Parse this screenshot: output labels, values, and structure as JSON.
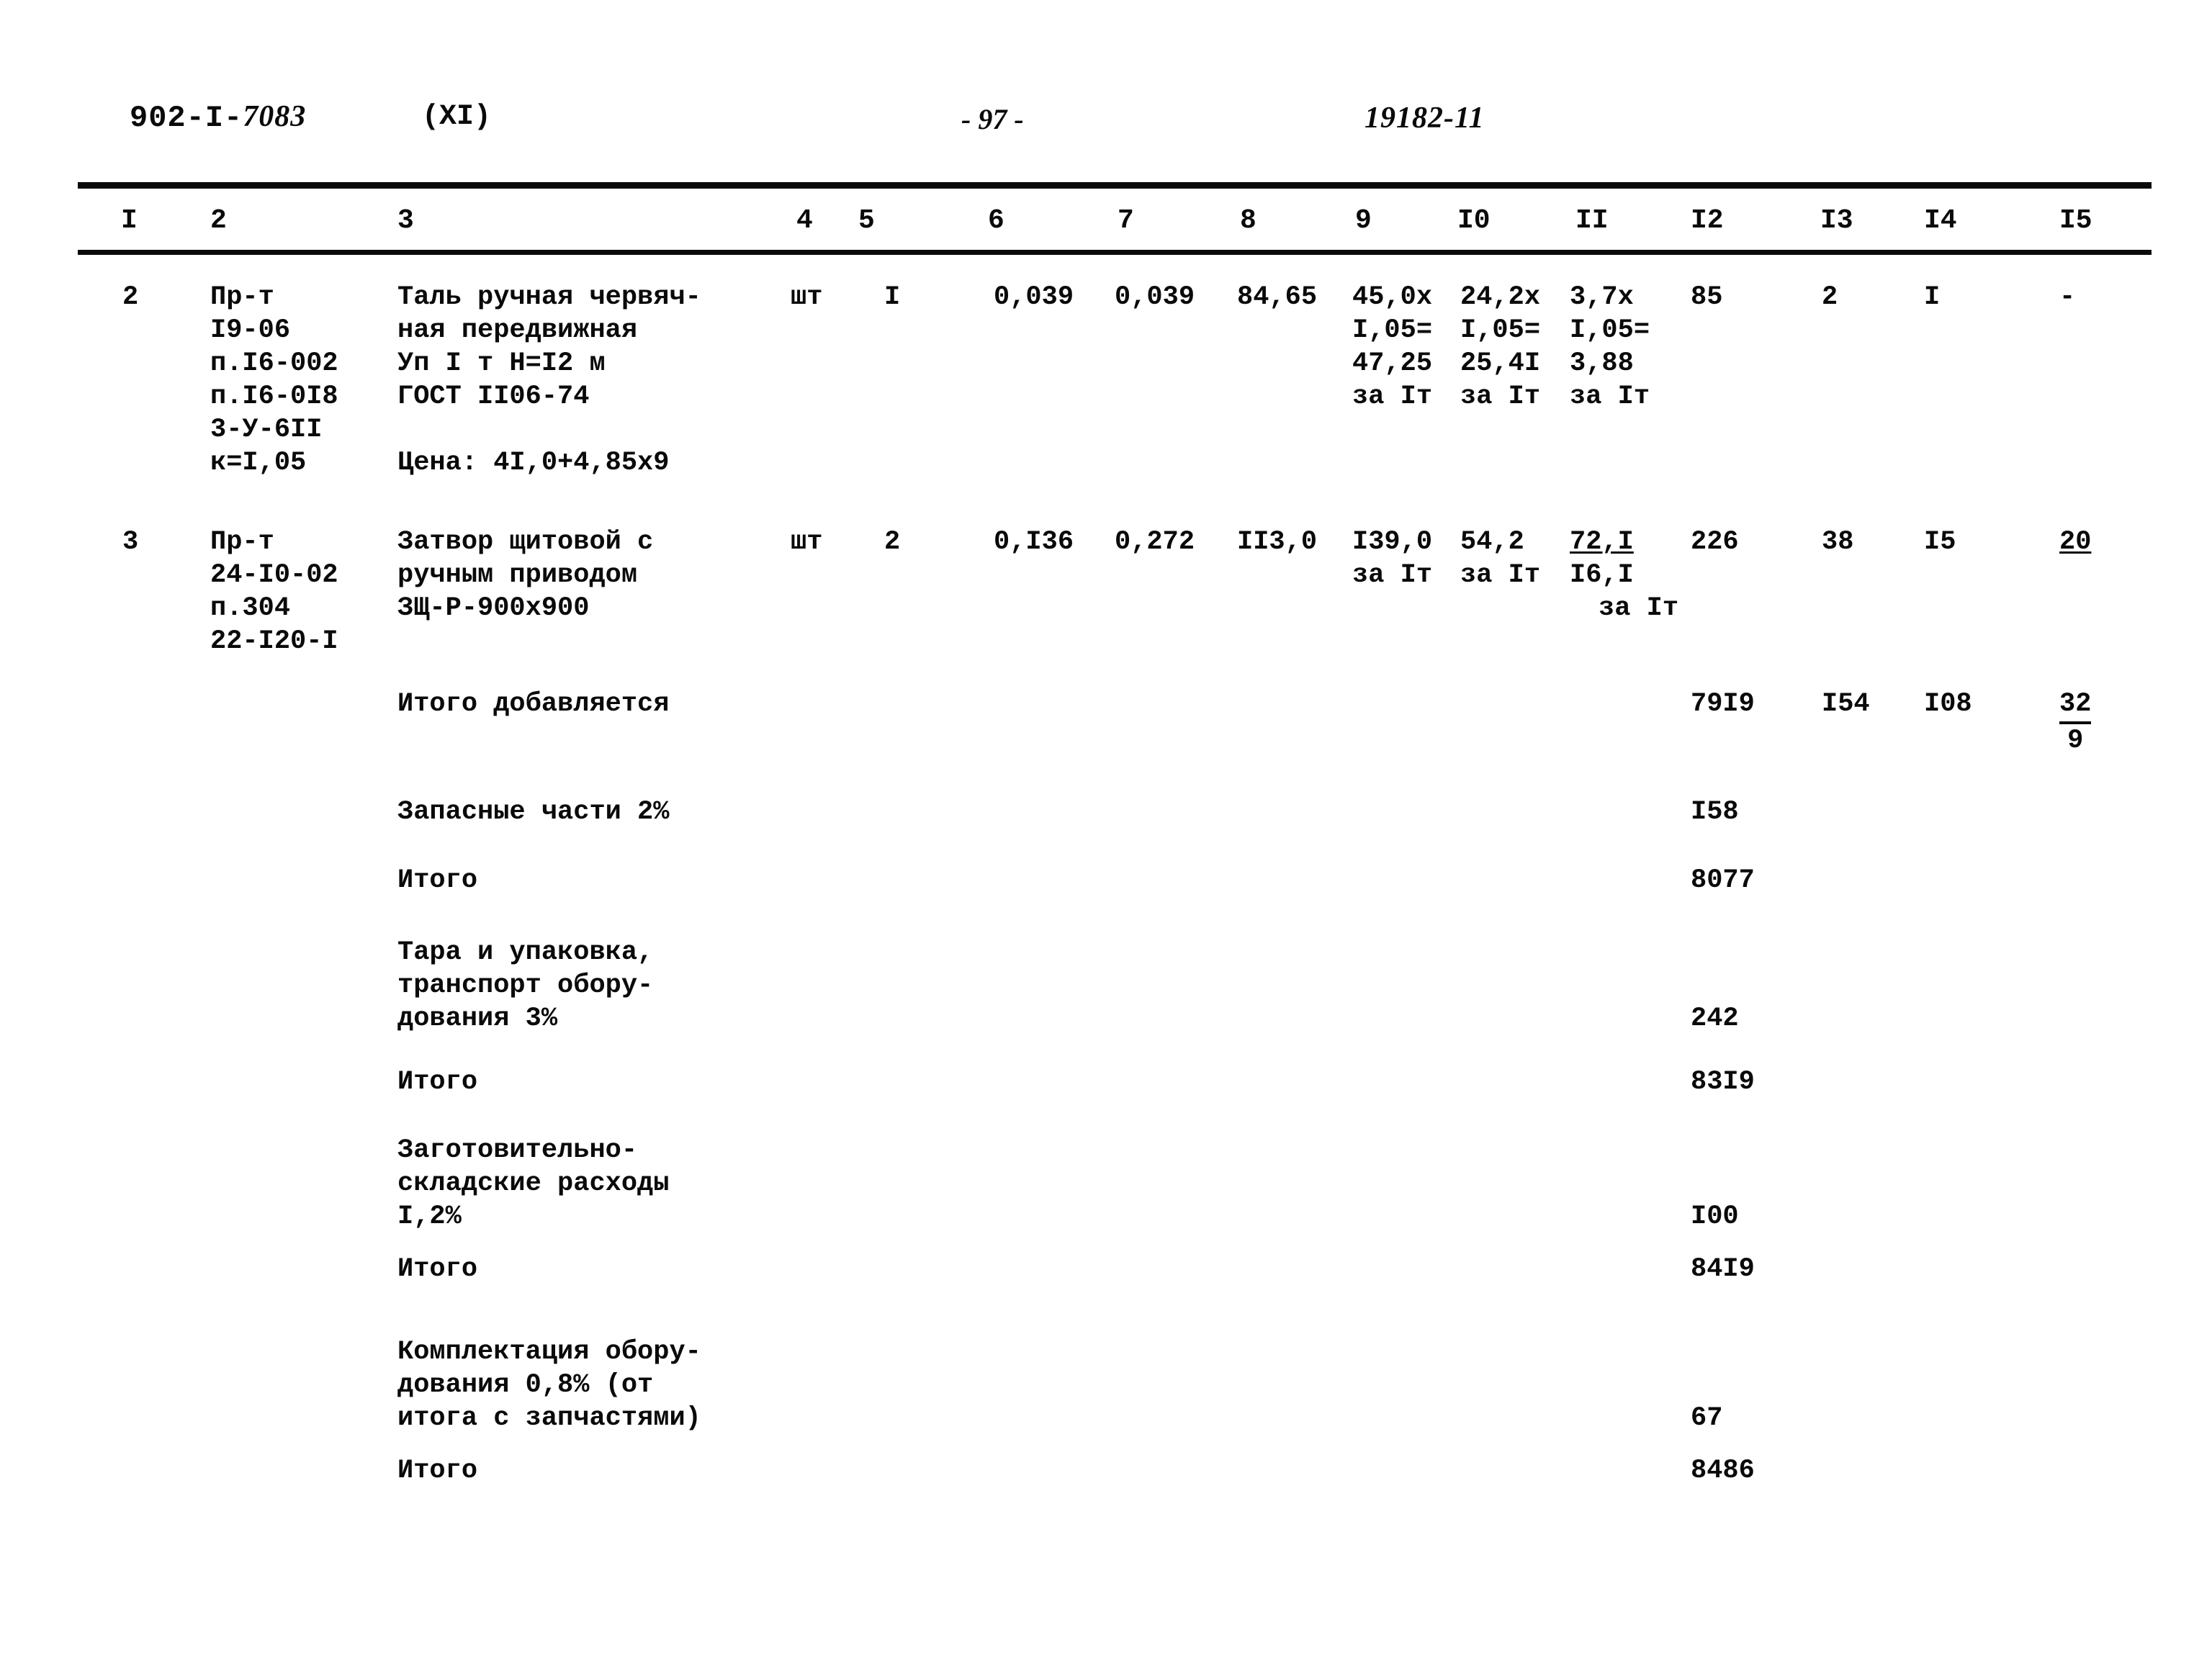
{
  "header": {
    "doc_code_prefix": "902-I-",
    "doc_code_hand": "7083",
    "volume": "(XI)",
    "page_number": "- 97 -",
    "archive_stamp": "19182-11"
  },
  "table": {
    "column_headers": [
      "I",
      "2",
      "3",
      "4",
      "5",
      "6",
      "7",
      "8",
      "9",
      "I0",
      "II",
      "I2",
      "I3",
      "I4",
      "I5"
    ],
    "rows": [
      {
        "pos": "2",
        "code_lines": [
          "Пр-т",
          "I9-06",
          "п.I6-002",
          "п.I6-0I8",
          "3-У-6II",
          "к=I,05"
        ],
        "name_lines": [
          "Таль ручная червяч-",
          "ная передвижная",
          "Уп I т Н=I2 м",
          "ГОСТ II06-74"
        ],
        "price_line": "Цена: 4I,0+4,85х9",
        "unit": "шт",
        "qty": "I",
        "c6": "0,039",
        "c7": "0,039",
        "c8": "84,65",
        "c9_lines": [
          "45,0х",
          "I,05=",
          "47,25",
          "за Iт"
        ],
        "c10_lines": [
          "24,2х",
          "I,05=",
          "25,4I",
          "за Iт"
        ],
        "c11_lines": [
          "3,7х",
          "I,05=",
          "3,88",
          "за Iт"
        ],
        "c12": "85",
        "c13": "2",
        "c14": "I",
        "c15": "-"
      },
      {
        "pos": "3",
        "code_lines": [
          "Пр-т",
          "24-I0-02",
          "п.304",
          "22-I20-I"
        ],
        "name_lines": [
          "Затвор щитовой с",
          "ручным приводом",
          "ЗЩ-Р-900х900"
        ],
        "price_line": "",
        "unit": "шт",
        "qty": "2",
        "c6": "0,I36",
        "c7": "0,272",
        "c8": "II3,0",
        "c9_lines": [
          "I39,0",
          "за Iт"
        ],
        "c10_lines": [
          "54,2",
          "за Iт"
        ],
        "c11_lines": [
          "72,I",
          "I6,I",
          "за Iт"
        ],
        "c12": "226",
        "c13": "38",
        "c14": "I5",
        "c15": "20"
      }
    ],
    "summary": [
      {
        "label_lines": [
          "Итого добавляется"
        ],
        "c12": "79I9",
        "c13": "I54",
        "c14": "I08",
        "c15_top": "32",
        "c15_bot": "9"
      },
      {
        "label_lines": [
          "Запасные части 2%"
        ],
        "c12": "I58"
      },
      {
        "label_lines": [
          "Итого"
        ],
        "c12": "8077"
      },
      {
        "label_lines": [
          "Тара и упаковка,",
          "транспорт обору-",
          "дования 3%"
        ],
        "c12": "242"
      },
      {
        "label_lines": [
          "Итого"
        ],
        "c12": "83I9"
      },
      {
        "label_lines": [
          "Заготовительно-",
          "складские расходы",
          "I,2%"
        ],
        "c12": "I00"
      },
      {
        "label_lines": [
          "Итого"
        ],
        "c12": "84I9"
      },
      {
        "label_lines": [
          "Комплектация обору-",
          "дования 0,8% (от",
          "итога с запчастями)"
        ],
        "c12": "67"
      },
      {
        "label_lines": [
          "Итого"
        ],
        "c12": "8486"
      }
    ]
  },
  "layout": {
    "col_x": [
      170,
      292,
      552,
      1098,
      1228,
      1380,
      1548,
      1718,
      1878,
      2028,
      2180,
      2348,
      2530,
      2672,
      2860
    ],
    "colhead_x": [
      168,
      292,
      552,
      1106,
      1192,
      1372,
      1552,
      1722,
      1882,
      2024,
      2188,
      2348,
      2528,
      2672,
      2860
    ]
  }
}
